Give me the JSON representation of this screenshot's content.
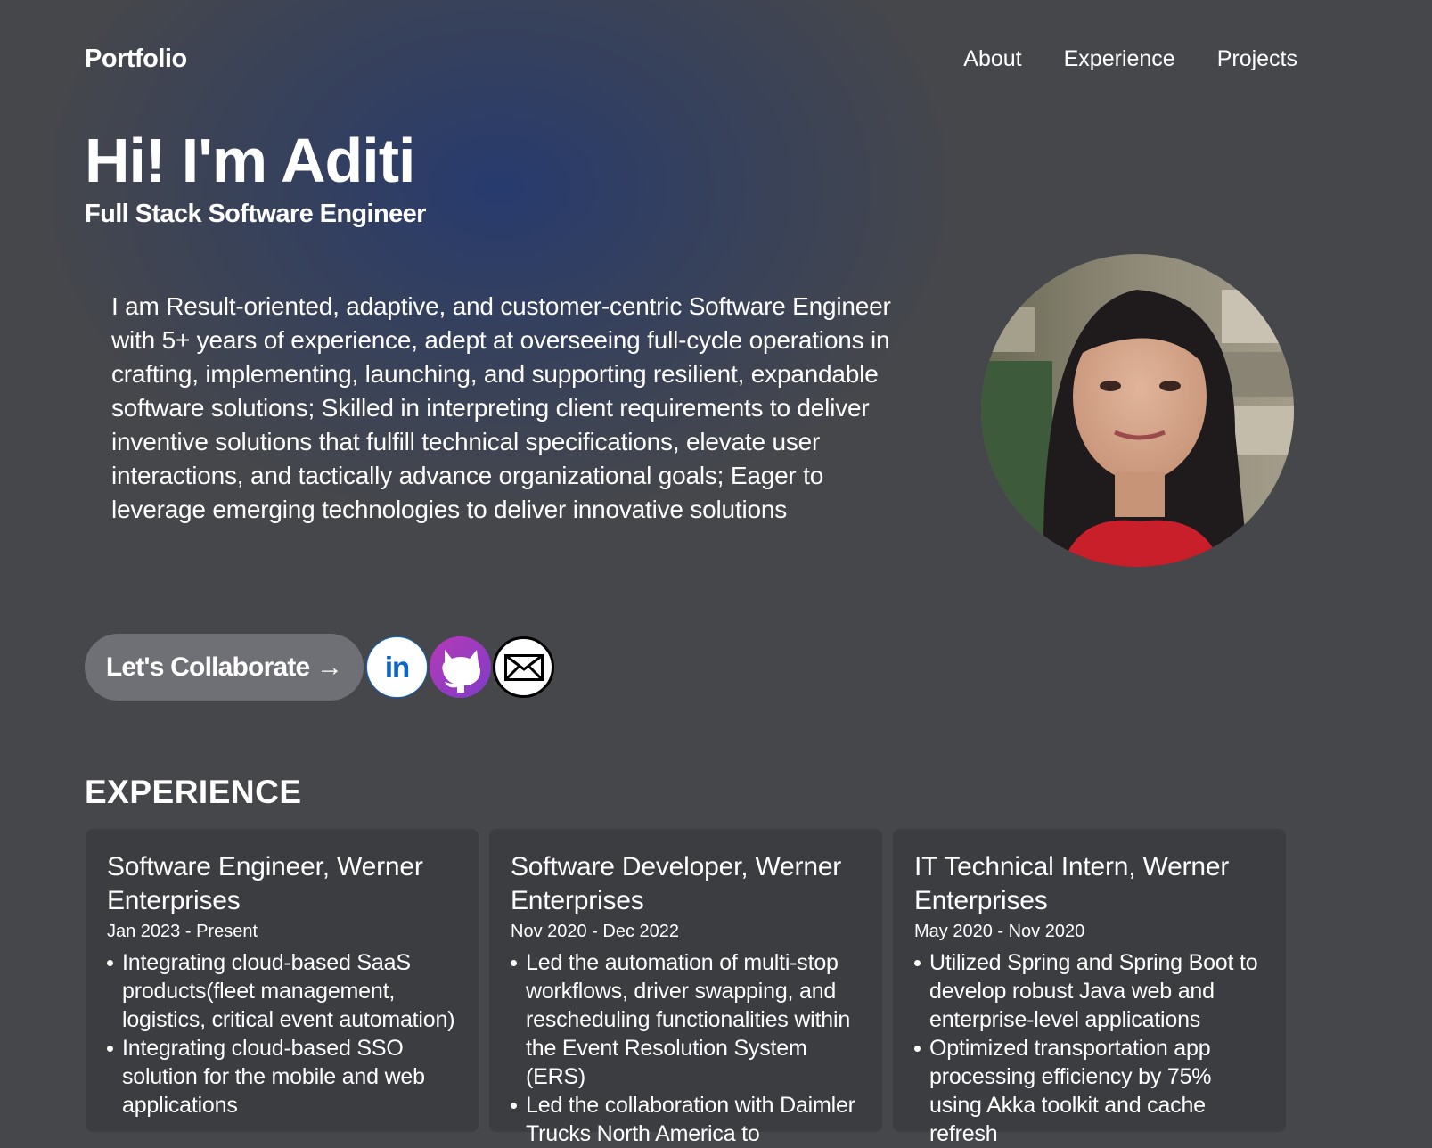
{
  "nav": {
    "brand": "Portfolio",
    "links": [
      "About",
      "Experience",
      "Projects"
    ]
  },
  "hero": {
    "greeting": "Hi! I'm Aditi",
    "role": "Full Stack Software Engineer",
    "bio": "I am Result-oriented, adaptive, and customer-centric Software Engineer with 5+ years of experience, adept at overseeing full-cycle operations in crafting, implementing, launching, and supporting resilient, expandable software solutions; Skilled in interpreting client requirements to deliver inventive solutions that fulfill technical specifications, elevate user interactions, and tactically advance organizational goals; Eager to leverage emerging technologies to deliver innovative solutions",
    "cta_label": "Let's Collaborate →",
    "linkedin_label": "in"
  },
  "experience": {
    "title": "EXPERIENCE",
    "jobs": [
      {
        "title": "Software Engineer, Werner Enterprises",
        "dates": "Jan 2023 - Present",
        "bullets": [
          "Integrating cloud-based SaaS products(fleet management, logistics, critical event automation)",
          "Integrating cloud-based SSO solution for the mobile and web applications"
        ]
      },
      {
        "title": "Software Developer, Werner Enterprises",
        "dates": "Nov 2020 - Dec 2022",
        "bullets": [
          "Led the automation of multi-stop workflows, driver swapping, and rescheduling functionalities within the Event Resolution System (ERS)",
          "Led the collaboration with Daimler Trucks North America to"
        ]
      },
      {
        "title": "IT Technical Intern, Werner Enterprises",
        "dates": "May 2020 - Nov 2020",
        "bullets": [
          "Utilized Spring and Spring Boot to develop robust Java web and enterprise-level applications",
          "Optimized transportation app processing efficiency by 75% using Akka toolkit and cache refresh"
        ]
      }
    ]
  },
  "colors": {
    "background": "#46474b",
    "glow": "#263a70",
    "button": "#6f7075",
    "card": "#3c3d41",
    "linkedin": "#0a66c2"
  },
  "icons": [
    "linkedin-icon",
    "github-icon",
    "mail-icon"
  ]
}
